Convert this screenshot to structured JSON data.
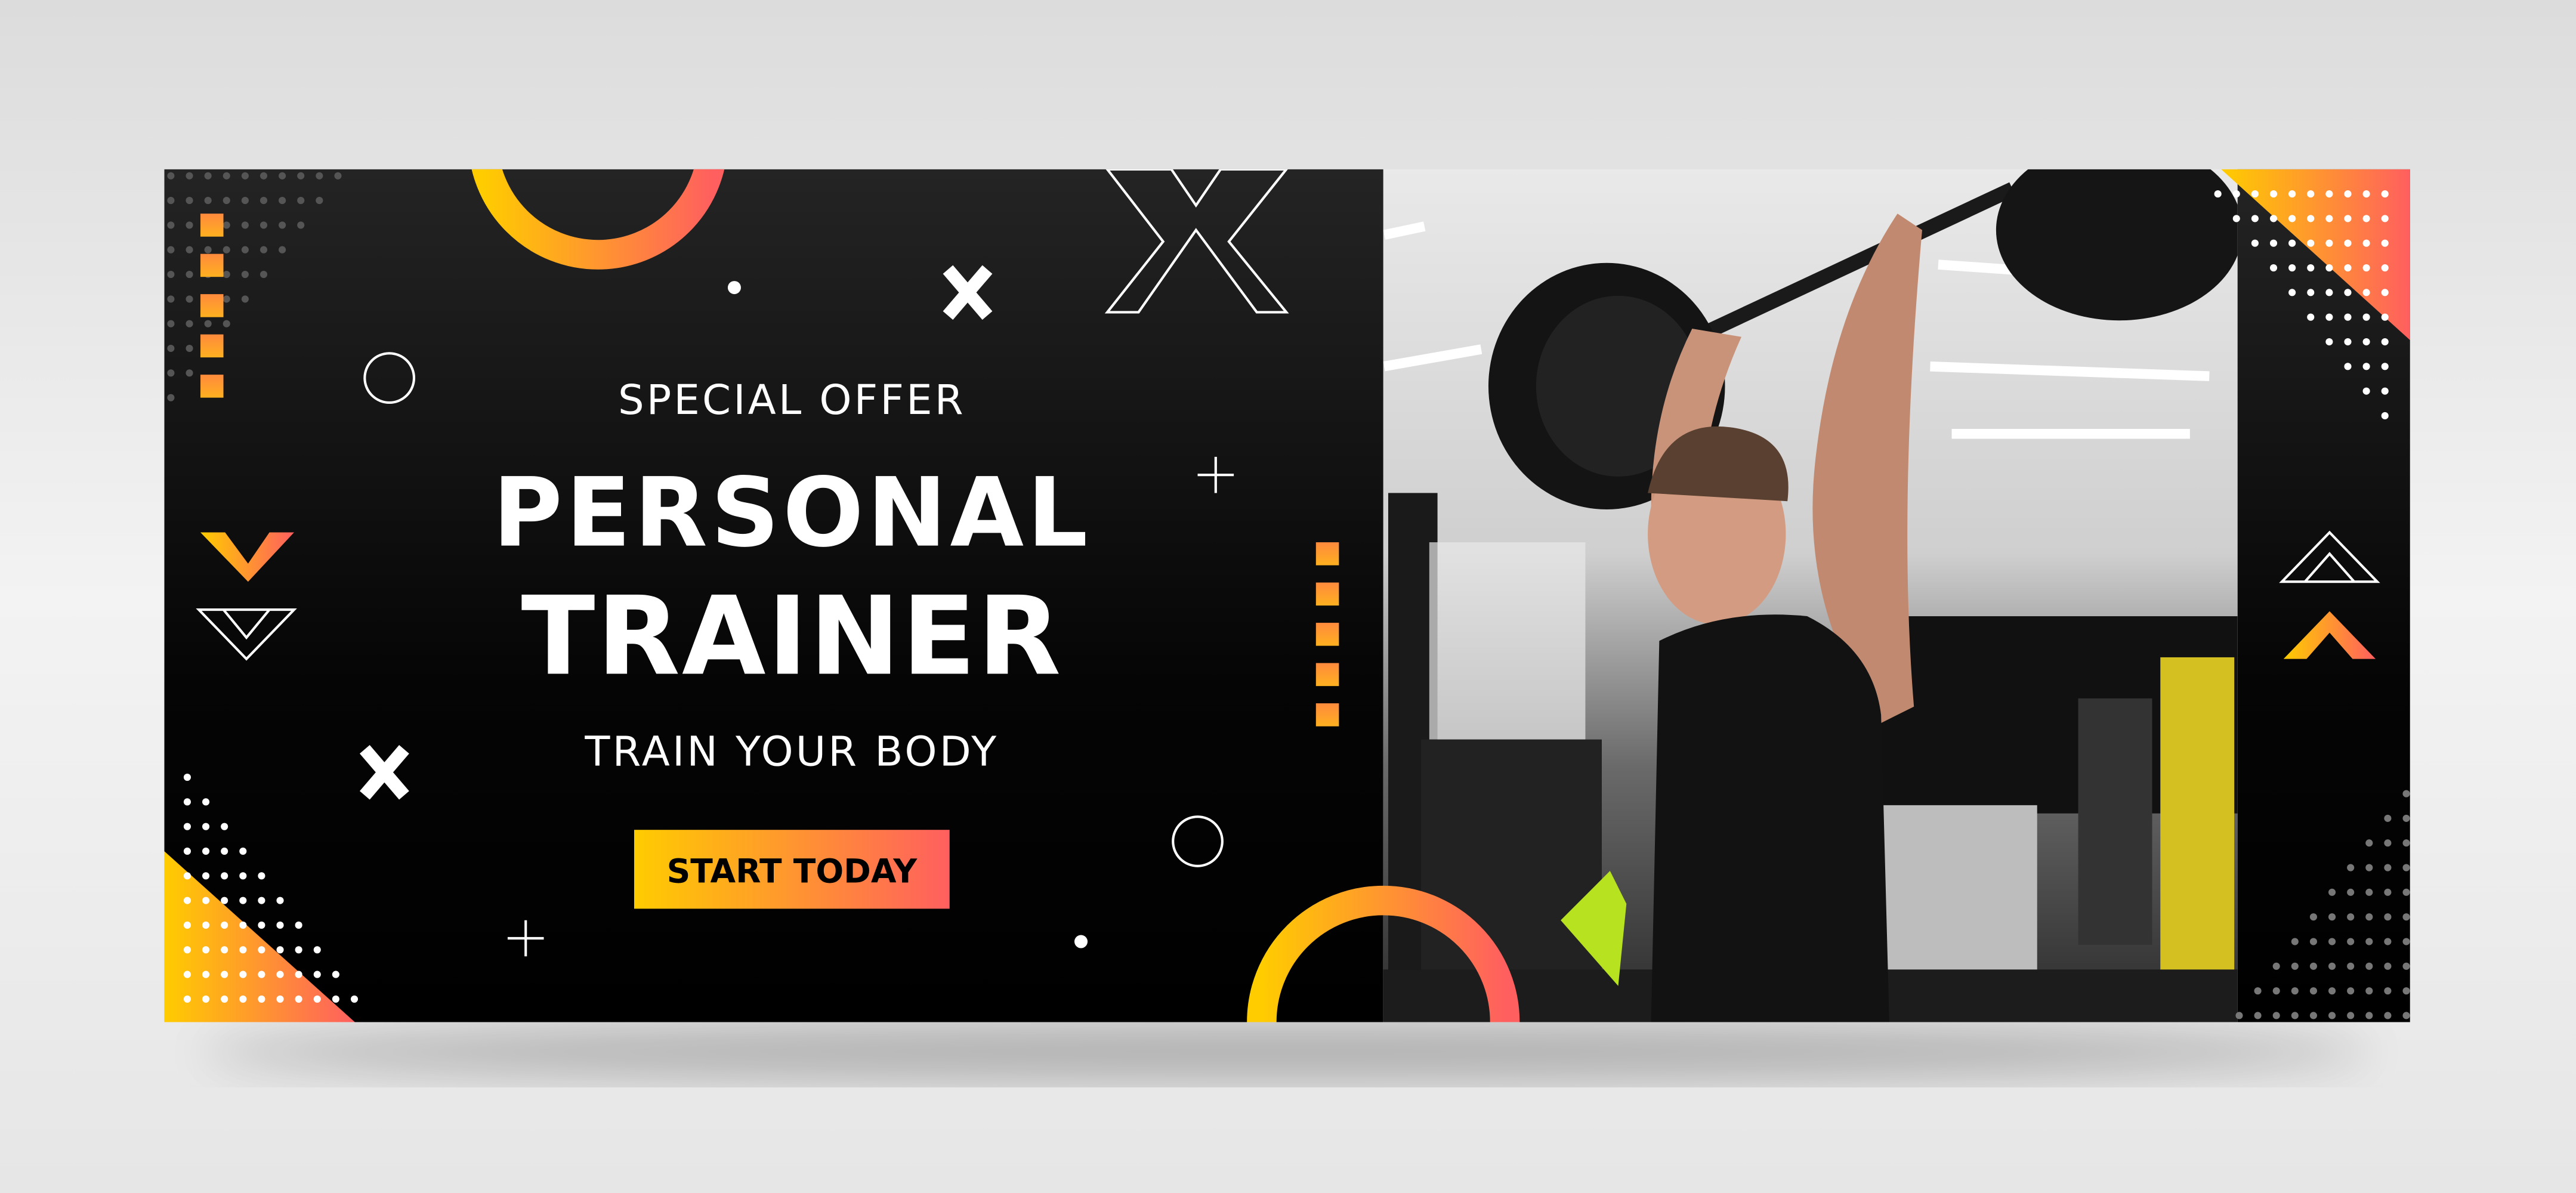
{
  "banner": {
    "eyebrow": "SPECIAL OFFER",
    "title_line1": "PERSONAL",
    "title_line2": "TRAINER",
    "tagline": "TRAIN YOUR BODY",
    "cta_label": "START TODAY"
  },
  "photo": {
    "subject": "man lifting barbell overhead in gym"
  },
  "colors": {
    "accent_start": "#ffcc00",
    "accent_end": "#ff5f5f",
    "panel_top": "#232323",
    "panel_bottom": "#000000",
    "text": "#ffffff"
  },
  "icons": [
    "x-outline-icon",
    "x-icon",
    "circle-icon",
    "plus-icon",
    "chevron-down-icon",
    "chevron-up-icon",
    "dot-grid-icon"
  ]
}
